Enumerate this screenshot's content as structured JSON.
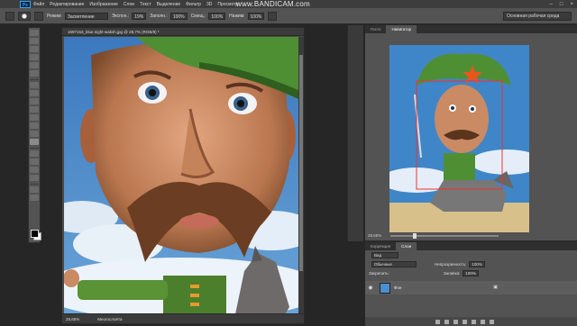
{
  "app": {
    "logo": "Ps"
  },
  "menu": [
    "Файл",
    "Редактирование",
    "Изображение",
    "Слои",
    "Текст",
    "Выделение",
    "Фильтр",
    "3D",
    "Просмотр"
  ],
  "watermark": {
    "prefix": "www.",
    "brand": "BANDICAM",
    "suffix": ".com"
  },
  "window_controls": {
    "minimize": "–",
    "maximize": "□",
    "close": "×"
  },
  "options": {
    "mode_label": "Режим:",
    "mode_value": "Засветление",
    "range_label": "Экспон.:",
    "range_value": "19%",
    "opacity_label": "Заполн.:",
    "opacity_value": "100%",
    "flow_label": "Смещ.:",
    "flow_value": "100%",
    "strength_label": "Нажим:",
    "strength_value": "100%",
    "workspace": "Основная рабочая среда"
  },
  "document": {
    "title": "1697153_blue.night-waksh.jpg @ 28,7% (RGB/8) *",
    "zoom": "28,65%",
    "status": "Многослоёта"
  },
  "navigator": {
    "tab_histogram": "Гисто",
    "tab_navigator": "Навигатор",
    "zoom": "28,65%"
  },
  "layers": {
    "tab_corrections": "Коррекция",
    "tab_layers": "Слои",
    "kind_label": "Вид",
    "blend_value": "Обычные",
    "opacity_label": "Непрозрачность:",
    "opacity_value": "100%",
    "lock_label": "Закрепить:",
    "fill_label": "Заливка:",
    "fill_value": "100%",
    "layer_name": "Фон"
  },
  "colors": {
    "app_bg": "#262626",
    "panel": "#535353",
    "sky": "#3e7fc3",
    "cap": "#4f8f34",
    "skin": "#c98a64",
    "mustache": "#6b3d22"
  }
}
